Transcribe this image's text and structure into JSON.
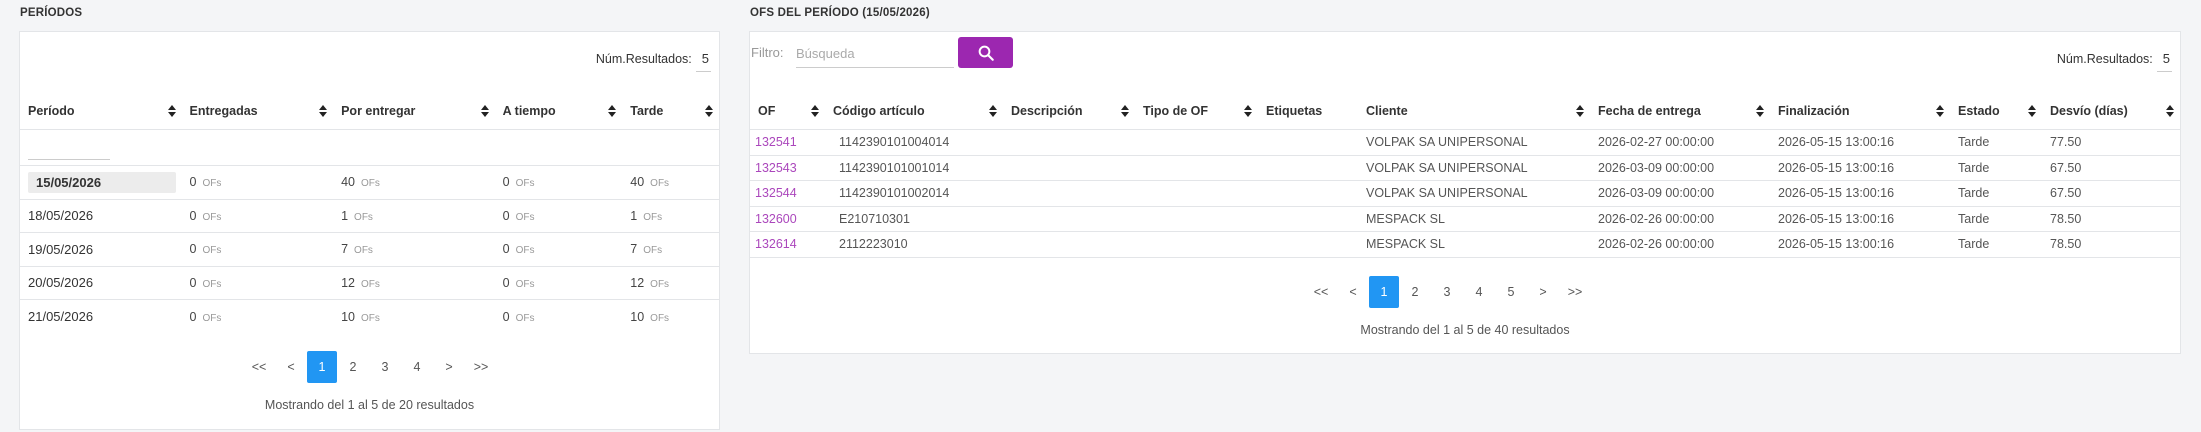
{
  "left": {
    "title": "PERÍODOS",
    "num_resultados_label": "Núm.Resultados:",
    "num_resultados_value": "5",
    "columns": [
      "Período",
      "Entregadas",
      "Por entregar",
      "A tiempo",
      "Tarde"
    ],
    "unit": "OFs",
    "rows": [
      {
        "periodo": "15/05/2026",
        "entregadas": "0",
        "por_entregar": "40",
        "a_tiempo": "0",
        "tarde": "40"
      },
      {
        "periodo": "18/05/2026",
        "entregadas": "0",
        "por_entregar": "1",
        "a_tiempo": "0",
        "tarde": "1"
      },
      {
        "periodo": "19/05/2026",
        "entregadas": "0",
        "por_entregar": "7",
        "a_tiempo": "0",
        "tarde": "7"
      },
      {
        "periodo": "20/05/2026",
        "entregadas": "0",
        "por_entregar": "12",
        "a_tiempo": "0",
        "tarde": "12"
      },
      {
        "periodo": "21/05/2026",
        "entregadas": "0",
        "por_entregar": "10",
        "a_tiempo": "0",
        "tarde": "10"
      }
    ],
    "pager": [
      "<<",
      "<",
      "1",
      "2",
      "3",
      "4",
      ">",
      ">>"
    ],
    "active_page": "1",
    "summary": "Mostrando del 1 al 5 de 20 resultados"
  },
  "right": {
    "title": "OFS DEL PERÍODO (15/05/2026)",
    "filter_label": "Filtro:",
    "filter_placeholder": "Búsqueda",
    "filter_value": "",
    "num_resultados_label": "Núm.Resultados:",
    "num_resultados_value": "5",
    "columns": [
      "OF",
      "Código artículo",
      "Descripción",
      "Tipo de OF",
      "Etiquetas",
      "Cliente",
      "Fecha de entrega",
      "Finalización",
      "Estado",
      "Desvío (días)"
    ],
    "rows": [
      [
        "132541",
        "1142390101004014",
        "",
        "",
        "",
        "VOLPAK SA UNIPERSONAL",
        "2026-02-27 00:00:00",
        "2026-05-15 13:00:16",
        "Tarde",
        "77.50"
      ],
      [
        "132543",
        "1142390101001014",
        "",
        "",
        "",
        "VOLPAK SA UNIPERSONAL",
        "2026-03-09 00:00:00",
        "2026-05-15 13:00:16",
        "Tarde",
        "67.50"
      ],
      [
        "132544",
        "1142390101002014",
        "",
        "",
        "",
        "VOLPAK SA UNIPERSONAL",
        "2026-03-09 00:00:00",
        "2026-05-15 13:00:16",
        "Tarde",
        "67.50"
      ],
      [
        "132600",
        "E210710301",
        "",
        "",
        "",
        "MESPACK SL",
        "2026-02-26 00:00:00",
        "2026-05-15 13:00:16",
        "Tarde",
        "78.50"
      ],
      [
        "132614",
        "2112223010",
        "",
        "",
        "",
        "MESPACK SL",
        "2026-02-26 00:00:00",
        "2026-05-15 13:00:16",
        "Tarde",
        "78.50"
      ]
    ],
    "pager": [
      "<<",
      "<",
      "1",
      "2",
      "3",
      "4",
      "5",
      ">",
      ">>"
    ],
    "active_page": "1",
    "summary": "Mostrando del 1 al 5 de 40 resultados"
  },
  "colors": {
    "accent": "#9c27b0",
    "link": "#ab47bc",
    "active_page": "#2196f3"
  },
  "icons": {
    "search": "search-icon",
    "sort": "sort-icon"
  }
}
